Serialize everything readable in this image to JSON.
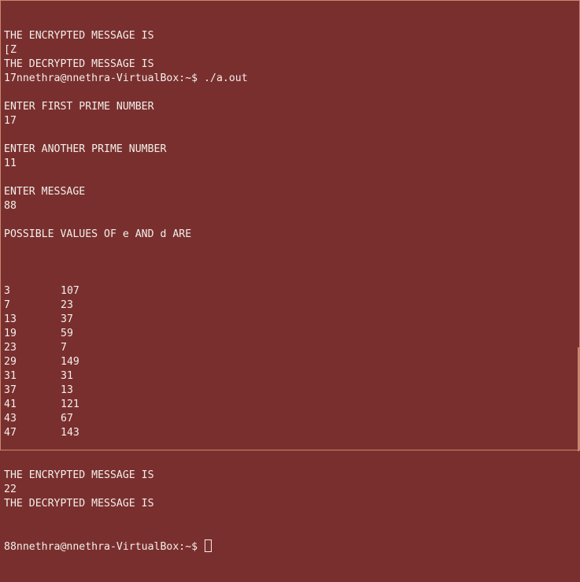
{
  "terminal": {
    "lines_top": [
      "THE ENCRYPTED MESSAGE IS",
      "[Z",
      "THE DECRYPTED MESSAGE IS",
      "17nnethra@nnethra-VirtualBox:~$ ./a.out",
      "",
      "ENTER FIRST PRIME NUMBER",
      "17",
      "",
      "ENTER ANOTHER PRIME NUMBER",
      "11",
      "",
      "ENTER MESSAGE",
      "88",
      "",
      "POSSIBLE VALUES OF e AND d ARE",
      ""
    ],
    "pairs": [
      {
        "e": "3",
        "d": "107"
      },
      {
        "e": "7",
        "d": "23"
      },
      {
        "e": "13",
        "d": "37"
      },
      {
        "e": "19",
        "d": "59"
      },
      {
        "e": "23",
        "d": "7"
      },
      {
        "e": "29",
        "d": "149"
      },
      {
        "e": "31",
        "d": "31"
      },
      {
        "e": "37",
        "d": "13"
      },
      {
        "e": "41",
        "d": "121"
      },
      {
        "e": "43",
        "d": "67"
      },
      {
        "e": "47",
        "d": "143"
      }
    ],
    "lines_bottom": [
      "THE ENCRYPTED MESSAGE IS",
      "22",
      "THE DECRYPTED MESSAGE IS"
    ],
    "prompt": "88nnethra@nnethra-VirtualBox:~$ ",
    "colors": {
      "background": "#7a2f2f",
      "text": "#f2efe9"
    }
  }
}
